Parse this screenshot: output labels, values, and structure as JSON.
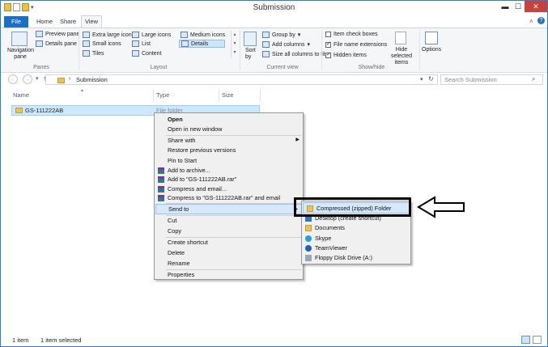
{
  "window": {
    "title": "Submission",
    "controls": {
      "minimize": "▬",
      "maximize": "☐",
      "close": "✕"
    }
  },
  "ribbon_tabs": [
    "File",
    "Home",
    "Share",
    "View"
  ],
  "ribbon": {
    "panes": {
      "navigation_pane": "Navigation pane",
      "preview_pane": "Preview pane",
      "details_pane": "Details pane",
      "group_label": "Panes"
    },
    "layout": {
      "extra_large": "Extra large icons",
      "large": "Large icons",
      "medium": "Medium icons",
      "small": "Small icons",
      "list": "List",
      "details": "Details",
      "tiles": "Tiles",
      "content": "Content",
      "group_label": "Layout"
    },
    "current_view": {
      "sort_by": "Sort by",
      "group_by": "Group by",
      "add_columns": "Add columns",
      "size_all": "Size all columns to fit",
      "group_label": "Current view"
    },
    "show_hide": {
      "item_check_boxes": "Item check boxes",
      "file_name_extensions": "File name extensions",
      "hidden_items": "Hidden items",
      "hide_selected": "Hide selected items",
      "group_label": "Show/hide"
    },
    "options": "Options"
  },
  "address": {
    "path": "Submission",
    "search_placeholder": "Search Submission"
  },
  "columns": [
    "Name",
    "Type",
    "Size"
  ],
  "files": [
    {
      "name": "GS-111222AB",
      "type": "File folder"
    }
  ],
  "context_menu": {
    "items": [
      "Open",
      "Open in new window",
      "Share with",
      "Restore previous versions",
      "Pin to Start",
      "Add to archive...",
      "Add to \"GS-111222AB.rar\"",
      "Compress and email...",
      "Compress to \"GS-111222AB.rar\" and email",
      "Send to",
      "Cut",
      "Copy",
      "Create shortcut",
      "Delete",
      "Rename",
      "Properties"
    ]
  },
  "send_to_menu": {
    "items": [
      "Compressed (zipped) Folder",
      "Desktop (create shortcut)",
      "Documents",
      "Skype",
      "TeamViewer",
      "Floppy Disk Drive (A:)"
    ]
  },
  "status": {
    "count": "1 item",
    "selected": "1 item selected"
  }
}
